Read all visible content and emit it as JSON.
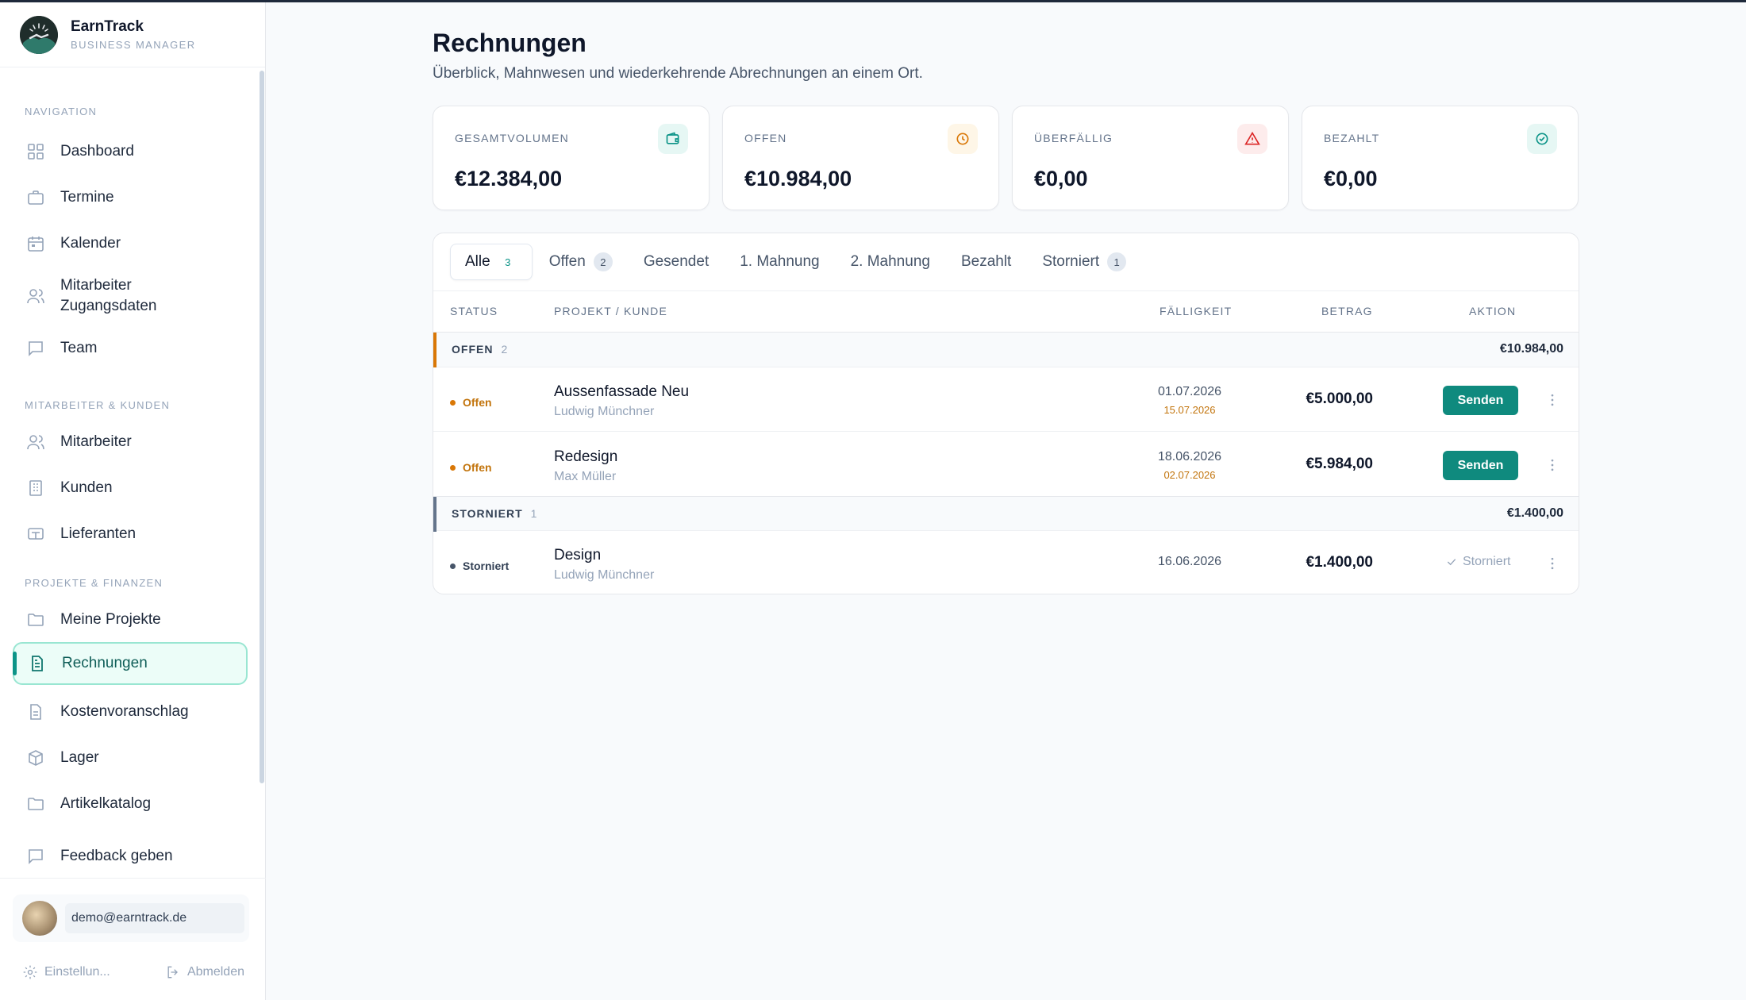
{
  "app": {
    "name": "EarnTrack",
    "subtitle": "BUSINESS MANAGER"
  },
  "sidebar": {
    "sections": {
      "navigation": "NAVIGATION",
      "people": "MITARBEITER & KUNDEN",
      "projects": "PROJEKTE & FINANZEN"
    },
    "items": [
      {
        "label": "Dashboard",
        "icon": "grid-icon"
      },
      {
        "label": "Termine",
        "icon": "briefcase-icon"
      },
      {
        "label": "Kalender",
        "icon": "calendar-icon"
      },
      {
        "label": "Mitarbeiter Zugangsdaten",
        "icon": "users-icon"
      },
      {
        "label": "Team",
        "icon": "chat-icon"
      },
      {
        "label": "Mitarbeiter",
        "icon": "users-icon"
      },
      {
        "label": "Kunden",
        "icon": "building-icon"
      },
      {
        "label": "Lieferanten",
        "icon": "truck-icon"
      },
      {
        "label": "Meine Projekte",
        "icon": "folder-icon"
      },
      {
        "label": "Rechnungen",
        "icon": "document-icon"
      },
      {
        "label": "Kostenvoranschlag",
        "icon": "document-icon"
      },
      {
        "label": "Lager",
        "icon": "box-icon"
      },
      {
        "label": "Artikelkatalog",
        "icon": "folder-icon"
      },
      {
        "label": "Feedback geben",
        "icon": "chat-icon"
      }
    ],
    "active": "Rechnungen",
    "user_email": "demo@earntrack.de",
    "settings_label": "Einstellun...",
    "logout_label": "Abmelden"
  },
  "page": {
    "title": "Rechnungen",
    "subtitle": "Überblick, Mahnwesen und wiederkehrende Abrechnungen an einem Ort."
  },
  "stats": [
    {
      "label": "GESAMTVOLUMEN",
      "value": "€12.384,00",
      "icon": "wallet-icon",
      "color": "#0d9488",
      "bg": "#e6f7f4"
    },
    {
      "label": "OFFEN",
      "value": "€10.984,00",
      "icon": "clock-icon",
      "color": "#d97706",
      "bg": "#fef6e7"
    },
    {
      "label": "ÜBERFÄLLIG",
      "value": "€0,00",
      "icon": "warning-icon",
      "color": "#dc2626",
      "bg": "#fdecec"
    },
    {
      "label": "BEZAHLT",
      "value": "€0,00",
      "icon": "check-circle-icon",
      "color": "#0d9488",
      "bg": "#e6f7f4"
    }
  ],
  "tabs": [
    {
      "label": "Alle",
      "count": "3"
    },
    {
      "label": "Offen",
      "count": "2"
    },
    {
      "label": "Gesendet",
      "count": ""
    },
    {
      "label": "1. Mahnung",
      "count": ""
    },
    {
      "label": "2. Mahnung",
      "count": ""
    },
    {
      "label": "Bezahlt",
      "count": ""
    },
    {
      "label": "Storniert",
      "count": "1"
    }
  ],
  "table": {
    "headers": {
      "status": "STATUS",
      "project": "PROJEKT / KUNDE",
      "due": "FÄLLIGKEIT",
      "amount": "BETRAG",
      "action": "AKTION"
    },
    "groups": [
      {
        "label": "OFFEN",
        "count": "2",
        "total": "€10.984,00",
        "color": "#d97706"
      },
      {
        "label": "STORNIERT",
        "count": "1",
        "total": "€1.400,00",
        "color": "#64748b"
      }
    ],
    "rows": [
      {
        "status": "Offen",
        "status_color": "#c2740c",
        "project": "Aussenfassade Neu",
        "client": "Ludwig Münchner",
        "due": "01.07.2026",
        "due_secondary": "15.07.2026",
        "amount": "€5.000,00",
        "action": "Senden"
      },
      {
        "status": "Offen",
        "status_color": "#c2740c",
        "project": "Redesign",
        "client": "Max Müller",
        "due": "18.06.2026",
        "due_secondary": "02.07.2026",
        "amount": "€5.984,00",
        "action": "Senden"
      },
      {
        "status": "Storniert",
        "status_color": "#334155",
        "project": "Design",
        "client": "Ludwig Münchner",
        "due": "16.06.2026",
        "due_secondary": "",
        "amount": "€1.400,00",
        "action": "Storniert"
      }
    ]
  }
}
